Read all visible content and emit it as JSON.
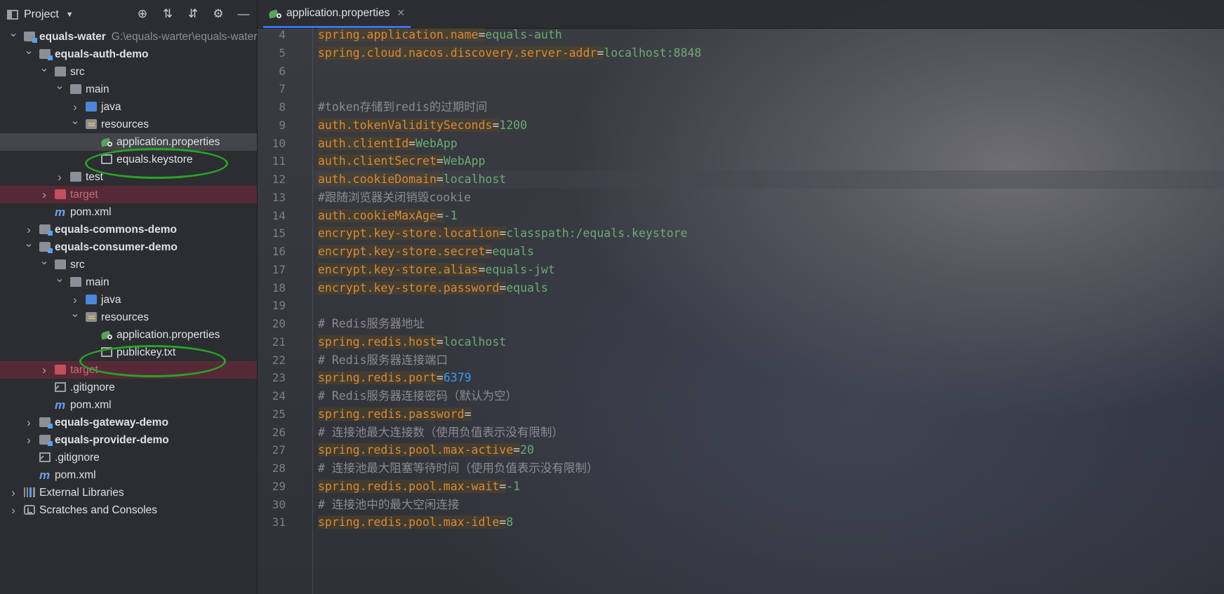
{
  "project_panel": {
    "title": "Project",
    "tree": [
      {
        "label": "equals-water",
        "hint": "G:\\equals-warter\\equals-water",
        "level": 0,
        "expanded": true,
        "icon": "module-icon",
        "bold": true
      },
      {
        "label": "equals-auth-demo",
        "level": 1,
        "expanded": true,
        "icon": "module-icon",
        "bold": true
      },
      {
        "label": "src",
        "level": 2,
        "expanded": true,
        "icon": "folder-icon"
      },
      {
        "label": "main",
        "level": 3,
        "expanded": true,
        "icon": "folder-icon"
      },
      {
        "label": "java",
        "level": 4,
        "expanded": false,
        "icon": "source-folder-icon"
      },
      {
        "label": "resources",
        "level": 4,
        "expanded": true,
        "icon": "resources-folder-icon"
      },
      {
        "label": "application.properties",
        "level": 5,
        "icon": "properties-file-icon",
        "selected": true
      },
      {
        "label": "equals.keystore",
        "level": 5,
        "icon": "text-file-icon"
      },
      {
        "label": "test",
        "level": 3,
        "expanded": false,
        "icon": "folder-icon"
      },
      {
        "label": "target",
        "level": 2,
        "expanded": false,
        "icon": "excluded-folder-icon",
        "excluded": true
      },
      {
        "label": "pom.xml",
        "level": 2,
        "icon": "maven-icon"
      },
      {
        "label": "equals-commons-demo",
        "level": 1,
        "expanded": false,
        "icon": "module-icon",
        "bold": true
      },
      {
        "label": "equals-consumer-demo",
        "level": 1,
        "expanded": true,
        "icon": "module-icon",
        "bold": true
      },
      {
        "label": "src",
        "level": 2,
        "expanded": true,
        "icon": "folder-icon"
      },
      {
        "label": "main",
        "level": 3,
        "expanded": true,
        "icon": "folder-icon"
      },
      {
        "label": "java",
        "level": 4,
        "expanded": false,
        "icon": "source-folder-icon"
      },
      {
        "label": "resources",
        "level": 4,
        "expanded": true,
        "icon": "resources-folder-icon"
      },
      {
        "label": "application.properties",
        "level": 5,
        "icon": "properties-file-icon"
      },
      {
        "label": "publickey.txt",
        "level": 5,
        "icon": "text-file-icon"
      },
      {
        "label": "target",
        "level": 2,
        "expanded": false,
        "icon": "excluded-folder-icon",
        "excluded": true
      },
      {
        "label": ".gitignore",
        "level": 2,
        "icon": "gitignore-icon"
      },
      {
        "label": "pom.xml",
        "level": 2,
        "icon": "maven-icon"
      },
      {
        "label": "equals-gateway-demo",
        "level": 1,
        "expanded": false,
        "icon": "module-icon",
        "bold": true
      },
      {
        "label": "equals-provider-demo",
        "level": 1,
        "expanded": false,
        "icon": "module-icon",
        "bold": true
      },
      {
        "label": ".gitignore",
        "level": 1,
        "icon": "gitignore-icon"
      },
      {
        "label": "pom.xml",
        "level": 1,
        "icon": "maven-icon"
      },
      {
        "label": "External Libraries",
        "level": 0,
        "expanded": false,
        "icon": "libraries-icon"
      },
      {
        "label": "Scratches and Consoles",
        "level": 0,
        "expanded": false,
        "icon": "scratches-icon"
      }
    ]
  },
  "editor": {
    "tab_label": "application.properties",
    "lines": [
      {
        "num": "4",
        "key": "spring.application.name",
        "value": "equals-auth"
      },
      {
        "num": "5",
        "key": "spring.cloud.nacos.discovery.server-addr",
        "value": "localhost:8848"
      },
      {
        "num": "6"
      },
      {
        "num": "7"
      },
      {
        "num": "8",
        "comment": "#token存储到redis的过期时间"
      },
      {
        "num": "9",
        "key": "auth.tokenValiditySeconds",
        "value": "1200"
      },
      {
        "num": "10",
        "key": "auth.clientId",
        "value": "WebApp"
      },
      {
        "num": "11",
        "key": "auth.clientSecret",
        "value": "WebApp"
      },
      {
        "num": "12",
        "key": "auth.cookieDomain",
        "value": "localhost",
        "current": true
      },
      {
        "num": "13",
        "comment": "#跟随浏览器关闭销毁cookie"
      },
      {
        "num": "14",
        "key": "auth.cookieMaxAge",
        "value": "-1"
      },
      {
        "num": "15",
        "key": "encrypt.key-store.location",
        "value": "classpath:/equals.keystore"
      },
      {
        "num": "16",
        "key": "encrypt.key-store.secret",
        "value": "equals"
      },
      {
        "num": "17",
        "key": "encrypt.key-store.alias",
        "value": "equals-jwt"
      },
      {
        "num": "18",
        "key": "encrypt.key-store.password",
        "value": "equals"
      },
      {
        "num": "19"
      },
      {
        "num": "20",
        "comment": "# Redis服务器地址"
      },
      {
        "num": "21",
        "key": "spring.redis.host",
        "value": "localhost"
      },
      {
        "num": "22",
        "comment": "# Redis服务器连接端口"
      },
      {
        "num": "23",
        "key": "spring.redis.port",
        "value": "6379",
        "numeric": true
      },
      {
        "num": "24",
        "comment": "# Redis服务器连接密码（默认为空）"
      },
      {
        "num": "25",
        "key": "spring.redis.password",
        "value": ""
      },
      {
        "num": "26",
        "comment": "# 连接池最大连接数（使用负值表示没有限制）"
      },
      {
        "num": "27",
        "key": "spring.redis.pool.max-active",
        "value": "20"
      },
      {
        "num": "28",
        "comment": "# 连接池最大阻塞等待时间（使用负值表示没有限制）"
      },
      {
        "num": "29",
        "key": "spring.redis.pool.max-wait",
        "value": "-1"
      },
      {
        "num": "30",
        "comment": "# 连接池中的最大空闲连接"
      },
      {
        "num": "31",
        "key": "spring.redis.pool.max-idle",
        "value": "8"
      }
    ]
  },
  "colors": {
    "accent": "#3574f0",
    "annotation_oval": "#29a329",
    "property_key": "#d58a3e",
    "property_value": "#6aab73",
    "number": "#3d9bf0",
    "comment": "#8a8c91"
  }
}
